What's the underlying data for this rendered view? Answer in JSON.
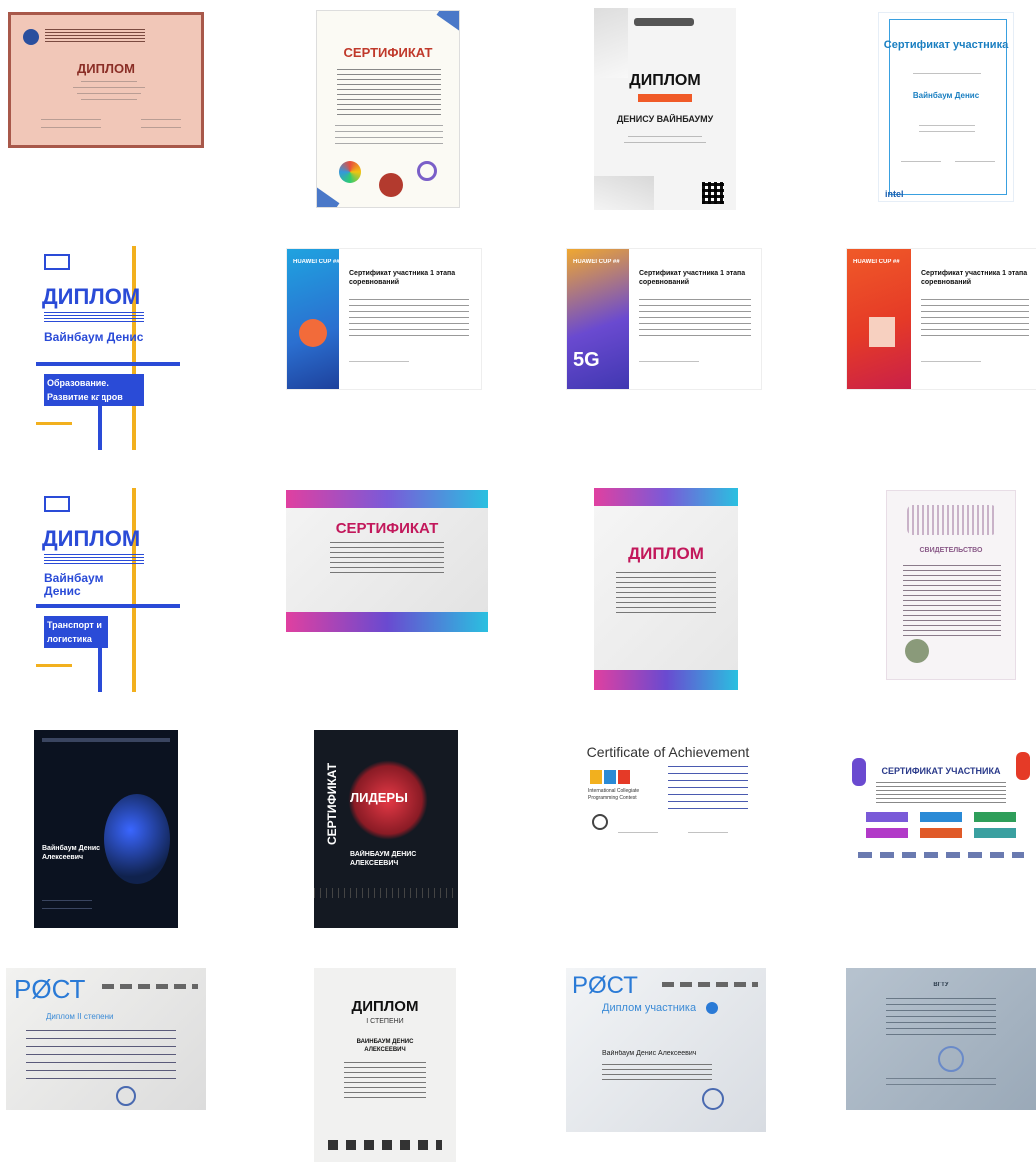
{
  "gallery": {
    "colors": {
      "blue_accent": "#2a4bd7",
      "yellow_accent": "#f2b01e",
      "navy_bg": "#0b1220",
      "peach_bg": "#f1c7b8",
      "huawei_blue": "#1f8ad6",
      "huawei_red": "#e53a27"
    },
    "items": [
      {
        "title": "ДИПЛОМ"
      },
      {
        "title": "СЕРТИФИКАТ"
      },
      {
        "title": "ДИПЛОМ",
        "name": "ДЕНИСУ ВАЙНБАУМУ"
      },
      {
        "title": "Сертификат участника",
        "name": "Вайнбаум Денис",
        "brand": "intel"
      },
      {
        "title": "ДИПЛОМ",
        "name": "Вайнбаум Денис",
        "track": "Образование. Развитие кадров"
      },
      {
        "title": "Сертификат участника 1 этапа соревнований",
        "brand": "HUAWEI CUP ##"
      },
      {
        "title": "Сертификат участника 1 этапа соревнований",
        "brand": "HUAWEI CUP ##",
        "badge": "5G"
      },
      {
        "title": "Сертификат участника 1 этапа соревнований",
        "brand": "HUAWEI CUP ##"
      },
      {
        "title": "ДИПЛОМ",
        "name": "Вайнбаум Денис",
        "track": "Транспорт и логистика"
      },
      {
        "title": "СЕРТИФИКАТ"
      },
      {
        "title": "ДИПЛОМ"
      },
      {
        "title": "СВИДЕТЕЛЬСТВО"
      },
      {
        "name": "Вайнбаум Денис Алексеевич"
      },
      {
        "title": "СЕРТИФИКАТ",
        "headline": "ЛИДЕРЫ",
        "name": "ВАЙНБАУМ ДЕНИС АЛЕКСЕЕВИЧ"
      },
      {
        "title": "Certificate of Achievement",
        "org": "International Collegiate Programming Contest"
      },
      {
        "title": "СЕРТИФИКАТ УЧАСТНИКА"
      },
      {
        "brand": "РØСТ",
        "title": "Диплом II степени"
      },
      {
        "title": "ДИПЛОМ",
        "subtitle": "I СТЕПЕНИ",
        "name": "ВАЙНБАУМ ДЕНИС АЛЕКСЕЕВИЧ"
      },
      {
        "brand": "РØСТ",
        "title": "Диплом участника",
        "name": "Вайнбаум Денис Алексеевич"
      },
      {
        "title": "ВГТУ"
      }
    ]
  }
}
